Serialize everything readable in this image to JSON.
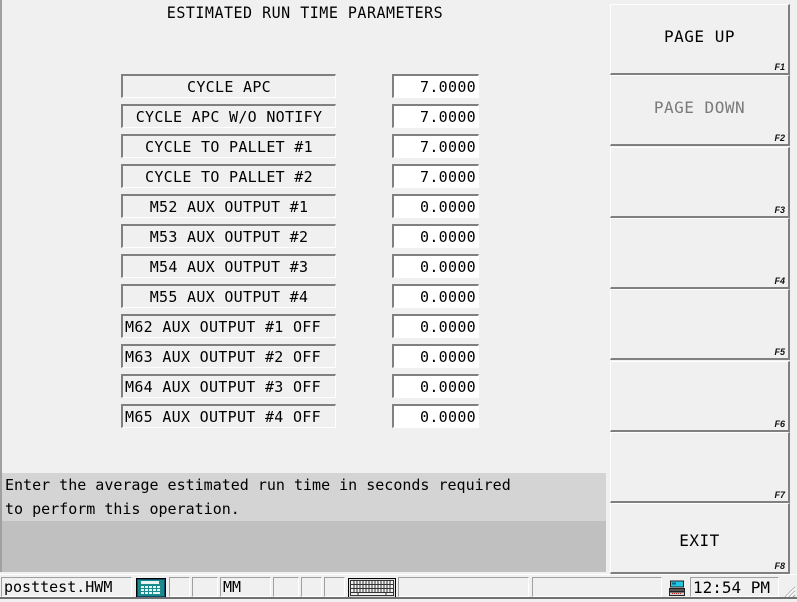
{
  "title": "ESTIMATED RUN TIME PARAMETERS",
  "parameters": [
    {
      "label": "CYCLE APC",
      "value": "7.0000"
    },
    {
      "label": "CYCLE APC W/O NOTIFY",
      "value": "7.0000"
    },
    {
      "label": "CYCLE TO PALLET #1",
      "value": "7.0000"
    },
    {
      "label": "CYCLE TO PALLET #2",
      "value": "7.0000"
    },
    {
      "label": "M52 AUX OUTPUT #1",
      "value": "0.0000"
    },
    {
      "label": "M53 AUX OUTPUT #2",
      "value": "0.0000"
    },
    {
      "label": "M54 AUX OUTPUT #3",
      "value": "0.0000"
    },
    {
      "label": "M55 AUX OUTPUT #4",
      "value": "0.0000"
    },
    {
      "label": "M62 AUX OUTPUT #1 OFF",
      "value": "0.0000"
    },
    {
      "label": "M63 AUX OUTPUT #2 OFF",
      "value": "0.0000"
    },
    {
      "label": "M64 AUX OUTPUT #3 OFF",
      "value": "0.0000"
    },
    {
      "label": "M65 AUX OUTPUT #4 OFF",
      "value": "0.0000"
    }
  ],
  "help_text": "Enter the average estimated run time in seconds required\nto perform this operation.",
  "function_keys": [
    {
      "key": "F1",
      "label": "PAGE UP",
      "enabled": true
    },
    {
      "key": "F2",
      "label": "PAGE DOWN",
      "enabled": false
    },
    {
      "key": "F3",
      "label": "",
      "enabled": true
    },
    {
      "key": "F4",
      "label": "",
      "enabled": true
    },
    {
      "key": "F5",
      "label": "",
      "enabled": true
    },
    {
      "key": "F6",
      "label": "",
      "enabled": true
    },
    {
      "key": "F7",
      "label": "",
      "enabled": true
    },
    {
      "key": "F8",
      "label": "EXIT",
      "enabled": true
    }
  ],
  "statusbar": {
    "filename": "posttest.HWM",
    "calculator_icon": "calculator-icon",
    "units": "MM",
    "keyboard_icon": "keyboard-icon",
    "network_icon": "computer-network-icon",
    "time": "12:54 PM"
  },
  "colors": {
    "background": "#f0f0f0",
    "help_band": "#d4d4d4",
    "help_lower": "#c0c0c0",
    "disabled_text": "#7a7a7a",
    "calculator_teal": "#1a8a8a"
  }
}
